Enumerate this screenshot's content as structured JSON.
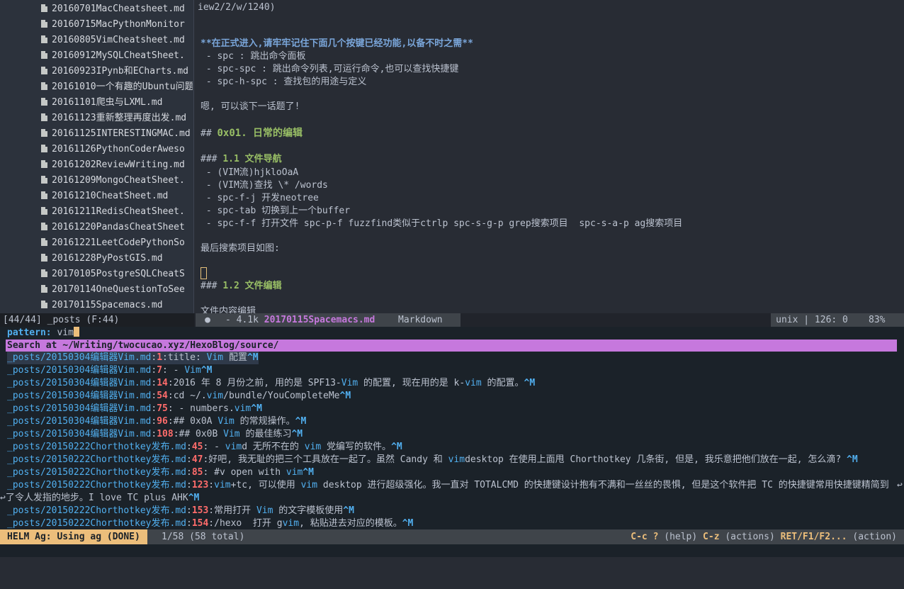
{
  "files": [
    "20160701MacCheatsheet.md",
    "20160715MacPythonMonitor",
    "20160805VimCheatsheet.md",
    "20160912MySQLCheatSheet.",
    "20160923IPynb和ECharts.md",
    "20161010一个有趣的Ubuntu问题",
    "20161101爬虫与LXML.md",
    "20161123重新整理再度出发.md",
    "20161125INTERESTINGMAC.md",
    "20161126PythonCoderAweso",
    "20161202ReviewWriting.md",
    "20161209MongoCheatSheet.",
    "20161210CheatSheet.md",
    "20161211RedisCheatSheet.",
    "20161220PandasCheatSheet",
    "20161221LeetCodePythonSo",
    "20161228PyPostGIS.md",
    "20170105PostgreSQLCheatS",
    "20170114OneQuestionToSee",
    "20170115Spacemacs.md"
  ],
  "editor": {
    "top_fragment": "iew2/2/w/1240)",
    "bold_note": "**在正式进入,请牢牢记住下面几个按键已经功能,以备不时之需**",
    "spc_1": " - spc : 跳出命令面板",
    "spc_2": " - spc-spc : 跳出命令列表,可运行命令,也可以查找快捷键",
    "spc_3": " - spc-h-spc : 查找包的用途与定义",
    "ok_line": "嗯, 可以谈下一话题了!",
    "h2_mark": "## ",
    "h2_text": "0x01. 日常的编辑",
    "h3a_mark": "### ",
    "h3a_text": "1.1 文件导航",
    "nav_1": " - (VIM流)hjkloOaA",
    "nav_2": " - (VIM流)查找 \\* /words",
    "nav_3": " - spc-f-j 开发neotree",
    "nav_4": " - spc-tab 切换到上一个buffer",
    "nav_5": " - spc-f-f 打开文件 spc-p-f fuzzfind类似于ctrlp spc-s-g-p grep搜索项目  spc-s-a-p ag搜索项目",
    "last_search": "最后搜索项目如图:",
    "h3b_mark": "### ",
    "h3b_text": "1.2 文件编辑",
    "content_edit": "文件内容编辑"
  },
  "mode_line": {
    "left": "[44/44] _posts (F:44)",
    "info": "●",
    "size": " - 4.1k ",
    "filename": "20170115Spacemacs.md",
    "major_mode": "Markdown",
    "position": "unix | 126: 0",
    "percent": "83%"
  },
  "helm": {
    "pattern_label": "pattern: ",
    "pattern_value": "vim",
    "header": "Search at ~/Writing/twocucao.xyz/HexoBlog/source/",
    "results": [
      {
        "path": "_posts/20150304编辑器Vim.md",
        "line": "1",
        "parts": [
          "title: ",
          "Vim",
          " 配置",
          "^M"
        ]
      },
      {
        "path": "_posts/20150304编辑器Vim.md",
        "line": "7",
        "parts": [
          " - ",
          "Vim",
          "",
          "^M"
        ]
      },
      {
        "path": "_posts/20150304编辑器Vim.md",
        "line": "14",
        "parts": [
          "2016 年 8 月份之前, 用的是 SPF13-",
          "Vim",
          " 的配置, 现在用的是 k-",
          "vim",
          " 的配置。",
          "^M"
        ]
      },
      {
        "path": "_posts/20150304编辑器Vim.md",
        "line": "54",
        "parts": [
          "cd ~/.",
          "vim",
          "/bundle/YouCompleteMe",
          "^M"
        ]
      },
      {
        "path": "_posts/20150304编辑器Vim.md",
        "line": "75",
        "parts": [
          " - numbers.",
          "vim",
          "",
          "^M"
        ]
      },
      {
        "path": "_posts/20150304编辑器Vim.md",
        "line": "96",
        "parts": [
          "## 0x0A ",
          "Vim",
          " 的常规操作。",
          "^M"
        ]
      },
      {
        "path": "_posts/20150304编辑器Vim.md",
        "line": "108",
        "parts": [
          "## 0x0B ",
          "Vim",
          " 的最佳练习",
          "^M"
        ]
      },
      {
        "path": "_posts/20150222Chorthotkey发布.md",
        "line": "45",
        "parts": [
          " - ",
          "vim",
          "d 无所不在的 ",
          "vim",
          " 党编写的软件。",
          "^M"
        ]
      },
      {
        "path": "_posts/20150222Chorthotkey发布.md",
        "line": "47",
        "parts": [
          "好吧, 我无耻的把三个工具放在一起了。虽然 Candy 和 ",
          "vim",
          "desktop 在使用上面甩 Chorthotkey 几条街, 但是, 我乐意把他们放在一起, 怎么滴? ",
          "^M"
        ]
      },
      {
        "path": "_posts/20150222Chorthotkey发布.md",
        "line": "85",
        "parts": [
          " #v open with ",
          "vim",
          "",
          "^M"
        ]
      },
      {
        "path": "_posts/20150222Chorthotkey发布.md",
        "line": "123",
        "parts": [
          "vim",
          "+tc, 可以使用 ",
          "vim",
          " desktop 进行超级强化。我一直对 TOTALCMD 的快捷键设计抱有不满和一丝丝的畏惧, 但是这个软件把 TC 的快捷键常用快捷键精简到 "
        ]
      },
      {
        "continuation": "了令人发指的地步。I love TC plus AHK",
        "ctrl": "^M"
      },
      {
        "path": "_posts/20150222Chorthotkey发布.md",
        "line": "153",
        "parts": [
          "常用打开 ",
          "Vim",
          " 的文字模板使用",
          "^M"
        ]
      },
      {
        "path": "_posts/20150222Chorthotkey发布.md",
        "line": "154",
        "parts": [
          "/hexo  打开 g",
          "vim",
          ", 粘贴进去对应的模板。",
          "^M"
        ]
      }
    ],
    "mode_tag": "HELM Ag: Using ag (DONE)",
    "count": "1/58 (58 total)",
    "keys": [
      {
        "key": "C-c ?",
        "desc": " (help) "
      },
      {
        "key": "C-z",
        "desc": " (actions) "
      },
      {
        "key": "RET/F1/F2...",
        "desc": " (action)"
      }
    ]
  },
  "colors": {
    "background": "#282c34",
    "helm_header": "#c678dd",
    "helm_tag": "#ecbe7b",
    "path": "#51afef",
    "line_number": "#ff6c6b",
    "heading": "#98be65"
  }
}
